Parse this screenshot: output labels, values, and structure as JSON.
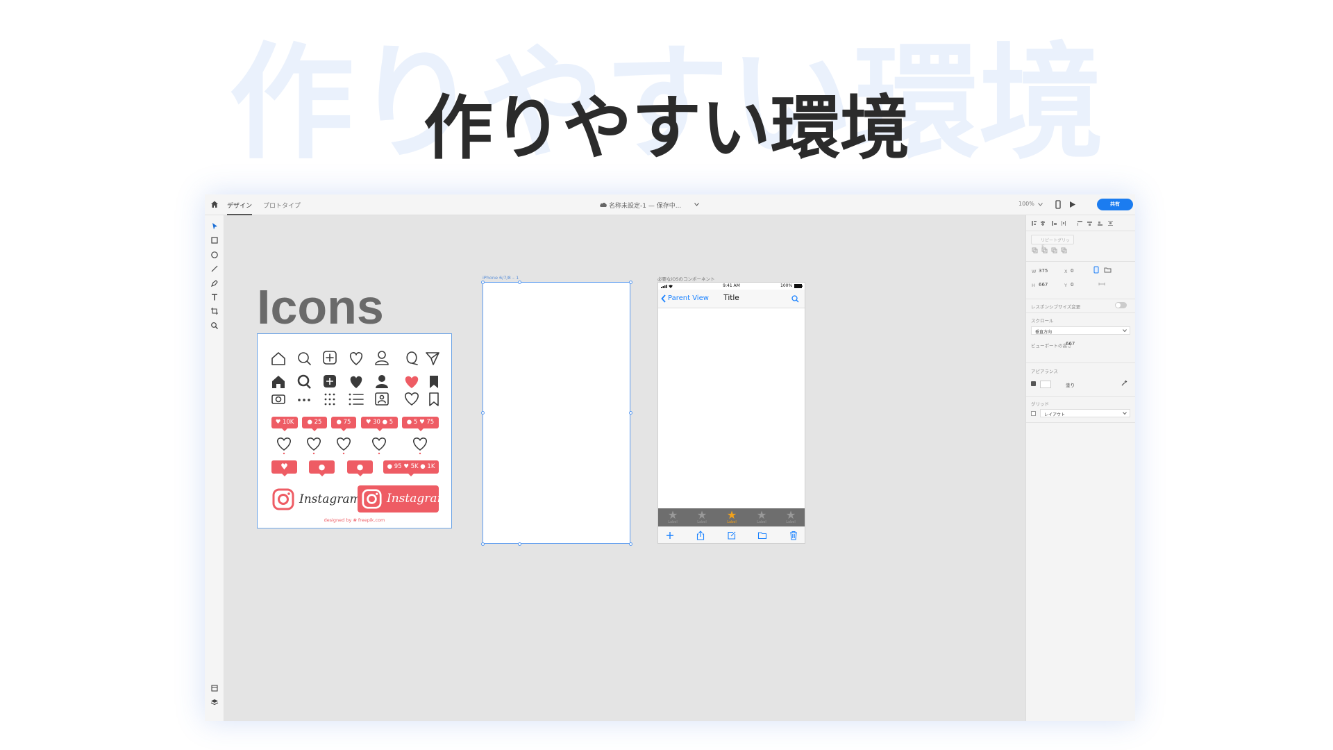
{
  "hero": {
    "title": "作りやすい環境",
    "bg_title": "作りやすい環境"
  },
  "app": {
    "tabs": [
      "デザイン",
      "プロトタイプ"
    ],
    "doc_title": "名称未設定-1 — 保存中...",
    "zoom": "100%",
    "share_label": "共有",
    "icons_heading": "Icons",
    "artboard_blank_label": "iPhone 6/7/8 – 1",
    "artboard_ios_label": "必要なiOSのコンポーネント",
    "icon_card": {
      "badges": [
        "10K",
        "25",
        "75",
        "30",
        "5",
        "5",
        "75",
        "95",
        "5K",
        "1K"
      ],
      "ig_brand": "Instagram",
      "credit": "designed by ❀ freepik.com"
    },
    "ios": {
      "time": "9:41 AM",
      "battery": "100%",
      "back_label": "Parent View",
      "title": "Title",
      "tab_labels": [
        "Label",
        "Label",
        "Label",
        "Label",
        "Label"
      ],
      "selected_tab": 2
    },
    "right_panel": {
      "repeat_grid": "リピートグリッド",
      "w_label": "W",
      "w_value": "375",
      "h_label": "H",
      "h_value": "667",
      "x_label": "X",
      "x_value": "0",
      "y_label": "Y",
      "y_value": "0",
      "responsive_label": "レスポンシブサイズ変更",
      "scroll_label": "スクロール",
      "scroll_value": "垂直方向",
      "viewport_label": "ビューポートの高さ",
      "viewport_value": "667",
      "appearance_label": "アピアランス",
      "fill_label": "塗り",
      "grid_label": "グリッド",
      "grid_value": "レイアウト"
    },
    "colors": {
      "accent": "#1b7cf0",
      "badge": "#ee5c64",
      "ios_blue": "#1a82ff",
      "tab_selected": "#f3a21a"
    }
  }
}
